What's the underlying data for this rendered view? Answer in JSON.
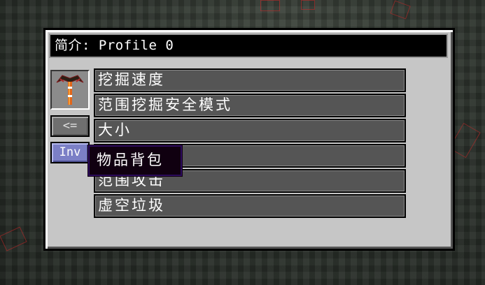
{
  "title": {
    "prefix": "简介:",
    "profile_name": "Profile 0"
  },
  "tool_slot": {
    "icon": "pickaxe-icon"
  },
  "buttons": {
    "back_label": "<=",
    "inventory_label": "Inv"
  },
  "modules": [
    {
      "label": "挖掘速度"
    },
    {
      "label": "范围挖掘安全模式"
    },
    {
      "label": "大小"
    },
    {
      "label": ""
    },
    {
      "label": "范围攻击"
    },
    {
      "label": "虚空垃圾"
    }
  ],
  "tooltip": {
    "text": "物品背包"
  },
  "colors": {
    "panel_bg": "#c6c6c6",
    "row_bg": "#555555",
    "inv_button": "#7b7fc6",
    "tooltip_bg": "#100010",
    "tooltip_border": "#2c0b5c"
  }
}
